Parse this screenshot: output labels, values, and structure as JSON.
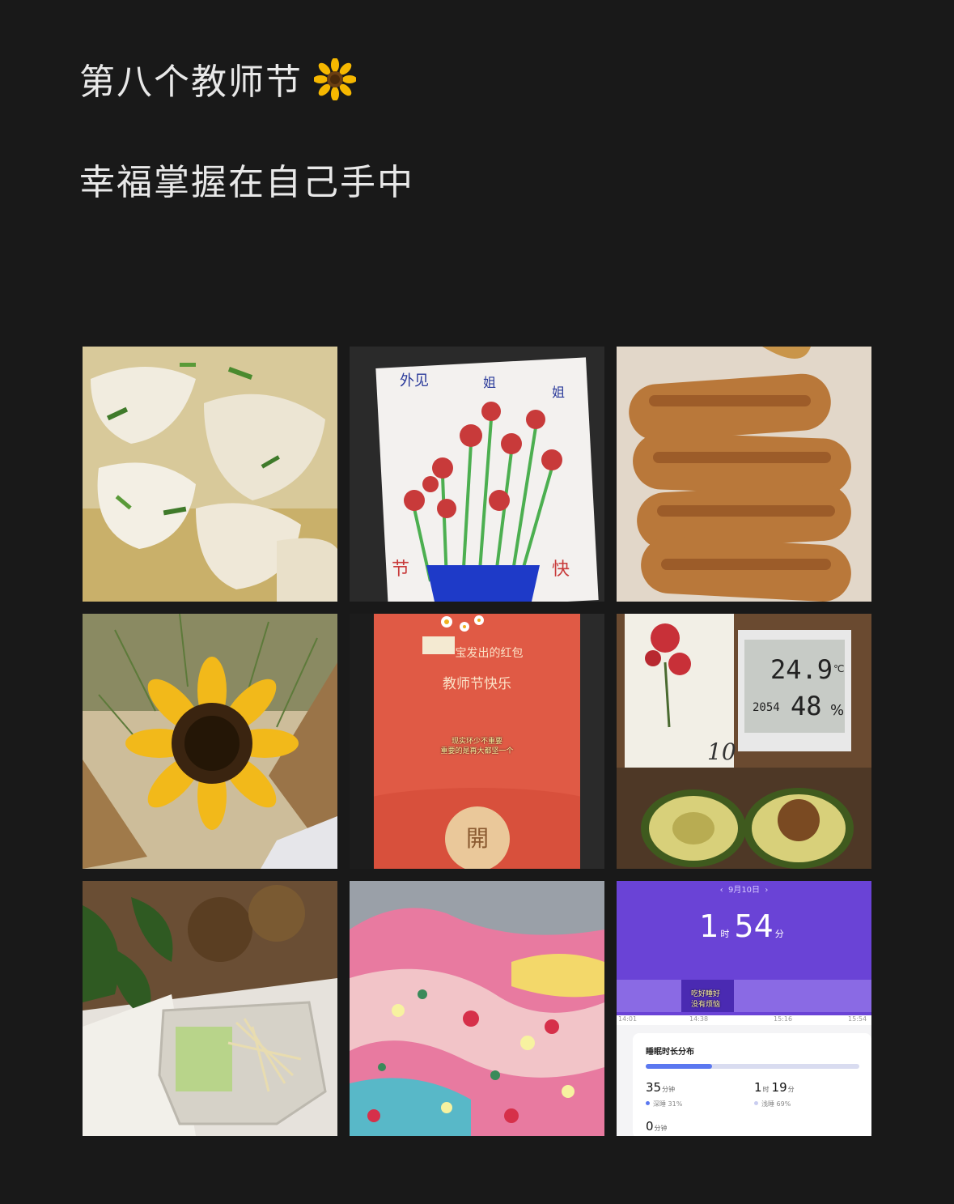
{
  "post": {
    "line1": "第八个教师节",
    "line1_emoji": "sunflower-emoji",
    "line2": "幸福掌握在自己手中"
  },
  "grid": {
    "count": 9,
    "photos": [
      {
        "subject": "wontons-in-soup"
      },
      {
        "subject": "child-drawing-of-flowers"
      },
      {
        "subject": "fried-dough-sticks"
      },
      {
        "subject": "sunflower-bouquet"
      },
      {
        "subject": "red-envelope-screenshot"
      },
      {
        "subject": "carnation-print-thermometer-avocado"
      },
      {
        "subject": "lunch-box-rice-greens"
      },
      {
        "subject": "floral-fabric"
      },
      {
        "subject": "sleep-app-screenshot"
      }
    ]
  },
  "drawing": {
    "top_left": "外见",
    "top_mid": "姐",
    "top_right": "姐",
    "bottom_left": "节",
    "bottom_right": "快"
  },
  "red_envelope": {
    "sender": "宝发出的红包",
    "title": "教师节快乐",
    "caption_line1": "现实环少不重要",
    "caption_line2": "重要的是再大都坚一个",
    "open_button": "開"
  },
  "thermometer": {
    "temperature": "24.9",
    "unit": "℃",
    "humidity": "48",
    "humidity_unit": "%",
    "small_reading": "2054",
    "calendar_day": "10"
  },
  "sleep_app": {
    "date": "9月10日",
    "total_hours": "1",
    "hours_unit": "时",
    "total_minutes": "54",
    "minutes_unit": "分",
    "caption_line1": "吃好睡好",
    "caption_line2": "没有烦恼",
    "axis_times": [
      "14:01",
      "14:38",
      "15:16",
      "15:54"
    ],
    "card_title": "睡眠时长分布",
    "deep_minutes": "35",
    "deep_unit": "分钟",
    "deep_label": "深睡 31%",
    "light_hours": "1",
    "light_hours_unit": "时",
    "light_minutes": "19",
    "light_minutes_unit": "分",
    "light_label": "浅睡 69%",
    "awake_minutes": "0",
    "awake_unit": "分钟",
    "deep_fraction": 0.31,
    "colors": {
      "deep": "#5b78f0",
      "light": "#d9dcf0",
      "header": "#6a43d6"
    }
  }
}
